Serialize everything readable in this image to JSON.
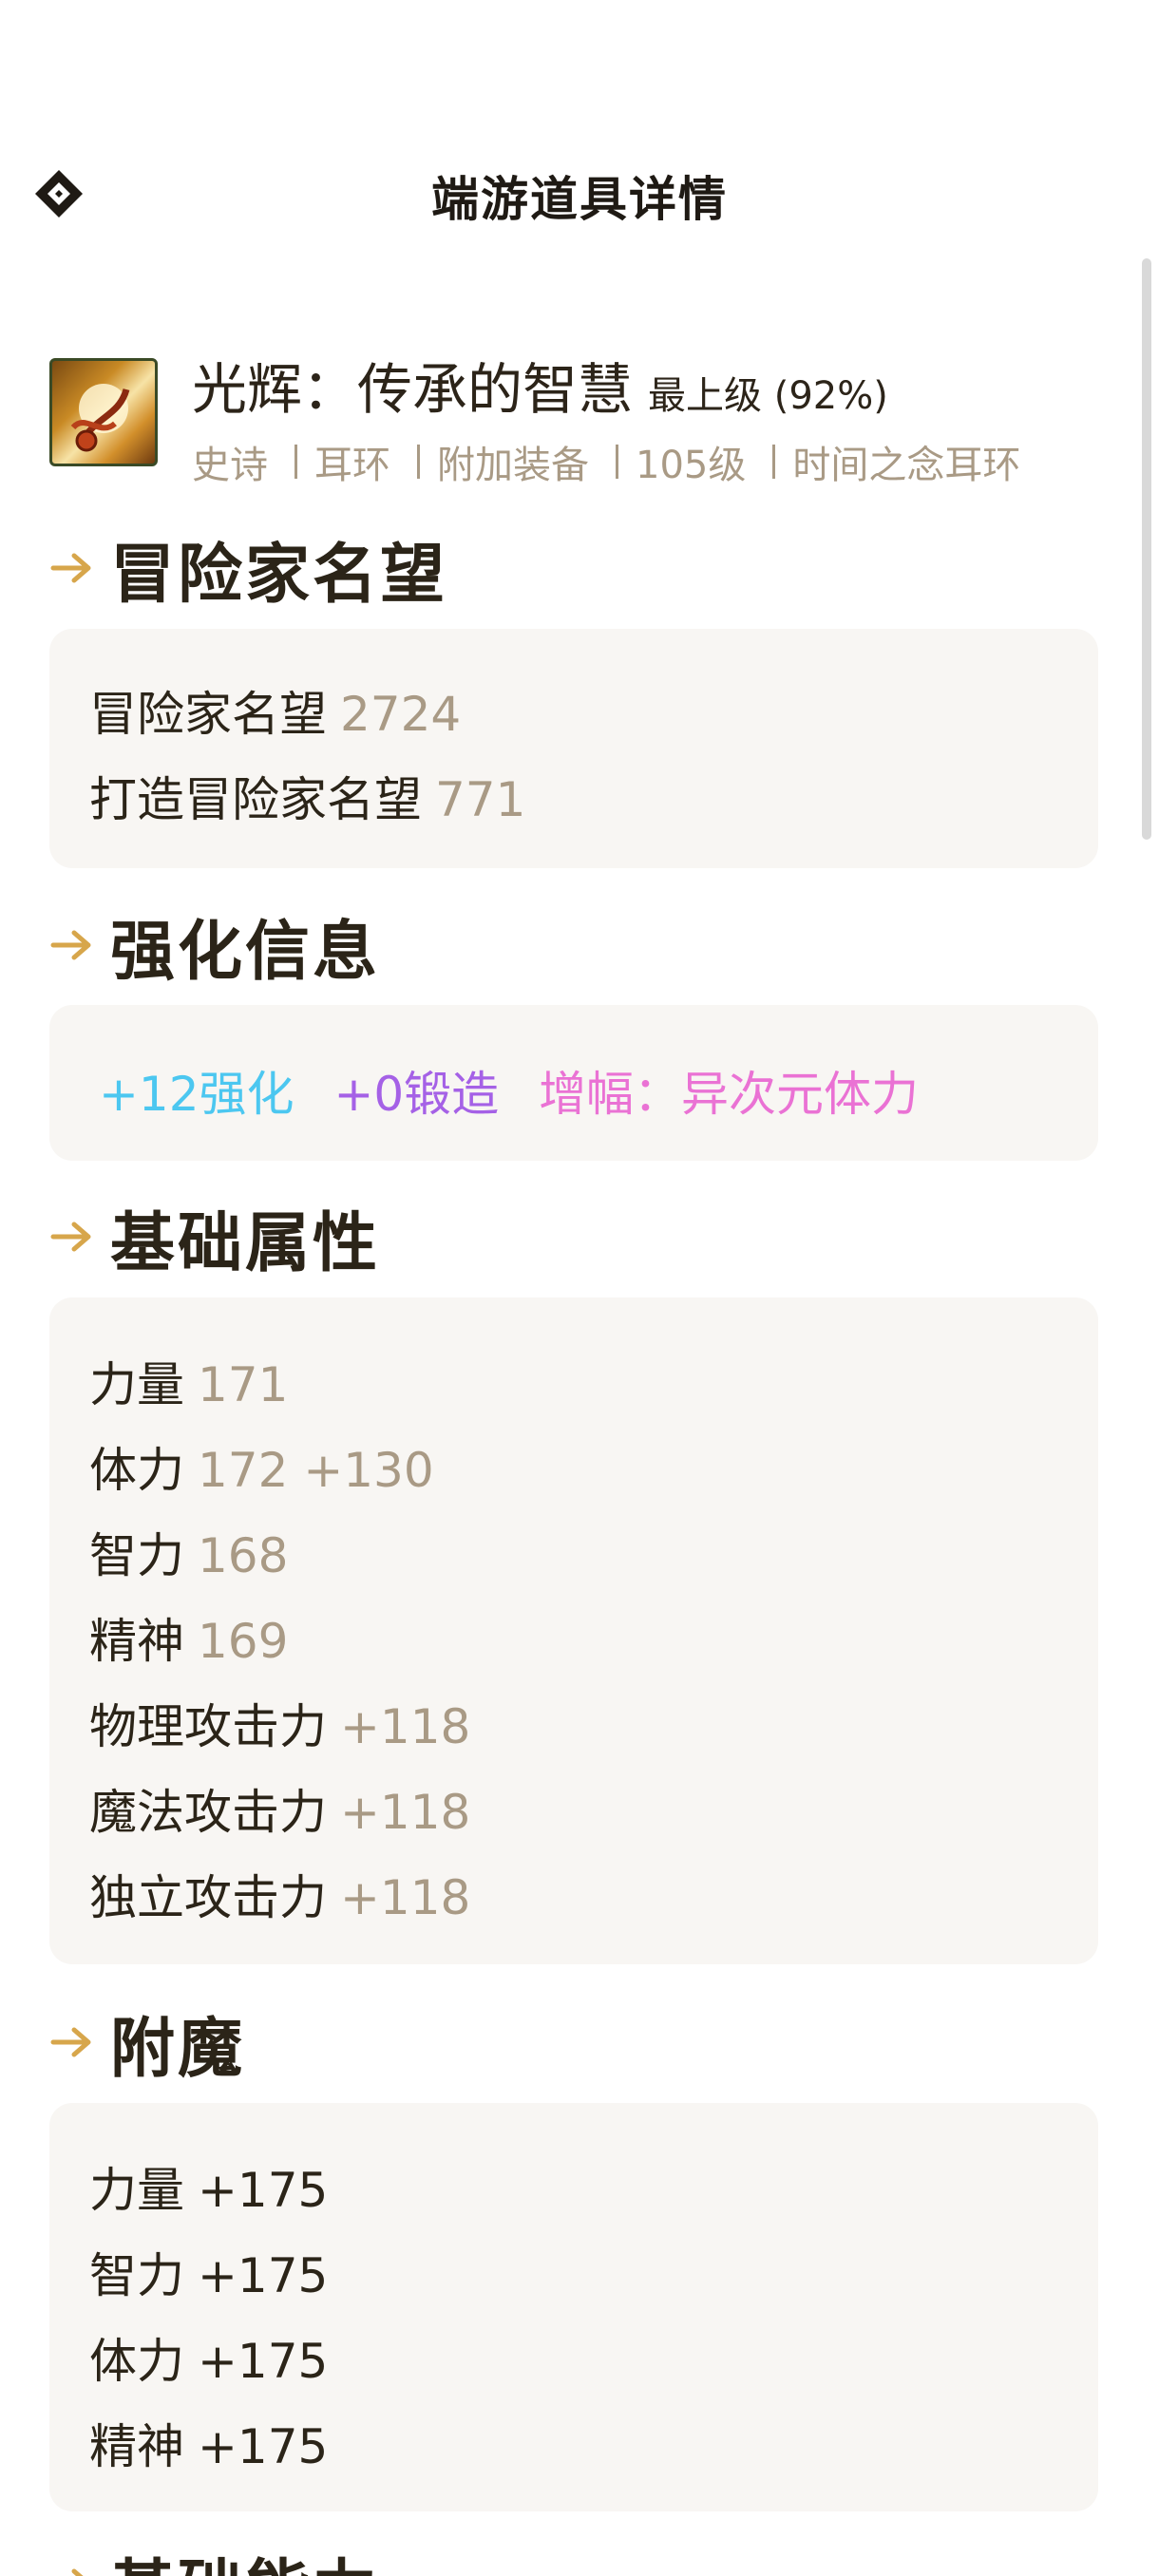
{
  "header": {
    "title": "端游道具详情"
  },
  "item": {
    "name": "光辉：传承的智慧",
    "grade": "最上级 (92%)",
    "tags": [
      "史诗",
      "耳环",
      "附加装备",
      "105级",
      "时间之念耳环"
    ]
  },
  "sections": {
    "fame": {
      "title": "冒险家名望",
      "rows": [
        {
          "label": "冒险家名望",
          "value": "2724"
        },
        {
          "label": "打造冒险家名望",
          "value": "771"
        }
      ]
    },
    "enhance": {
      "title": "强化信息",
      "reinforce": "+12强化",
      "forge": "+0锻造",
      "amplify": "增幅：异次元体力",
      "colors": {
        "reinforce": "#4cc7f0",
        "forge": "#a561e6",
        "amplify": "#ea72d4"
      }
    },
    "base": {
      "title": "基础属性",
      "rows": [
        {
          "label": "力量",
          "value": "171"
        },
        {
          "label": "体力",
          "value": "172 +130"
        },
        {
          "label": "智力",
          "value": "168"
        },
        {
          "label": "精神",
          "value": "169"
        },
        {
          "label": "物理攻击力",
          "value": "+118"
        },
        {
          "label": "魔法攻击力",
          "value": "+118"
        },
        {
          "label": "独立攻击力",
          "value": "+118"
        }
      ]
    },
    "enchant": {
      "title": "附魔",
      "rows": [
        {
          "label": "力量",
          "value": "+175"
        },
        {
          "label": "智力",
          "value": "+175"
        },
        {
          "label": "体力",
          "value": "+175"
        },
        {
          "label": "精神",
          "value": "+175"
        }
      ]
    },
    "next": {
      "title": "基础能力"
    }
  },
  "colors": {
    "accent": "#d7a64b",
    "muted": "#a99a85",
    "card_bg": "#f8f6f3"
  },
  "icons": {
    "back": "back-diamond-icon",
    "section": "arrow-right-icon",
    "item": "earring-item-icon"
  }
}
